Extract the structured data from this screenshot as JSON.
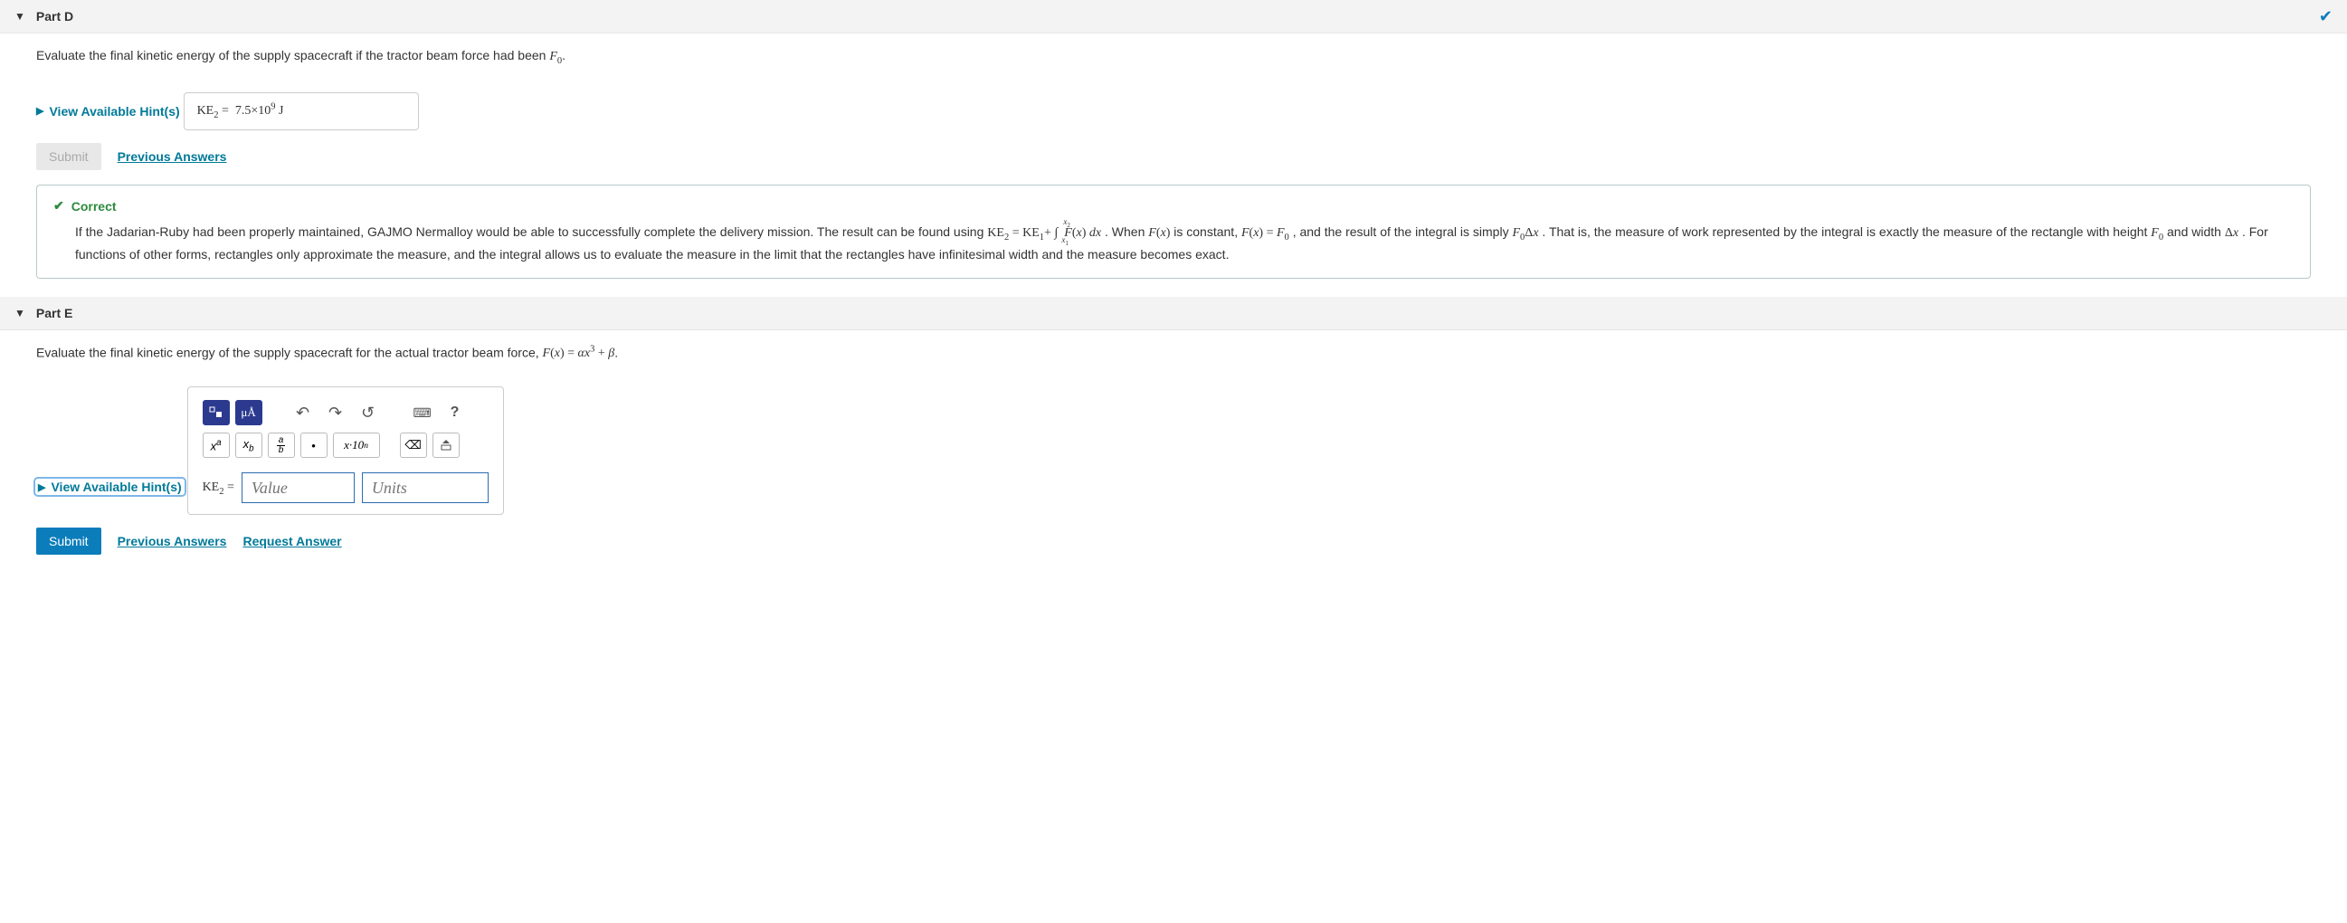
{
  "partD": {
    "title": "Part D",
    "prompt_pre": "Evaluate the final kinetic energy of the supply spacecraft if the tractor beam force had been ",
    "prompt_post": ".",
    "hints": "View Available Hint(s)",
    "answer_lhs": "KE",
    "answer_sub": "2",
    "answer_eq": " = ",
    "answer_val": "7.5×10",
    "answer_exp": "9",
    "answer_unit": " J",
    "submit": "Submit",
    "prev": "Previous Answers",
    "correct": "Correct",
    "fb_1": "If the Jadarian-Ruby had been properly maintained, GAJMO Nermalloy would be able to successfully complete the delivery mission. The result can be found using ",
    "fb_2": ". When ",
    "fb_3": " is constant, ",
    "fb_4": ", and the result of the integral is simply ",
    "fb_5": ". That is, the measure of work represented by the integral is exactly the measure of the rectangle with height ",
    "fb_6": " and width ",
    "fb_7": ". For functions of other forms, rectangles only approximate the measure, and the integral allows us to evaluate the measure in the limit that the rectangles have infinitesimal width and the measure becomes exact."
  },
  "partE": {
    "title": "Part E",
    "prompt_pre": "Evaluate the final kinetic energy of the supply spacecraft for the actual tractor beam force, ",
    "prompt_post": ".",
    "hints": "View Available Hint(s)",
    "lhs": "KE",
    "lhs_sub": "2",
    "eq": " = ",
    "value_ph": "Value",
    "units_ph": "Units",
    "submit": "Submit",
    "prev": "Previous Answers",
    "req": "Request Answer",
    "tb": {
      "templates": "▫◼",
      "greek": "μÅ",
      "undo": "↶",
      "redo": "↷",
      "reset": "↺",
      "keyboard": "⌨",
      "help": "?",
      "sup": "x",
      "sup_a": "a",
      "sub": "x",
      "sub_b": "b",
      "dot": "•",
      "sci": "x·10",
      "sci_n": "n",
      "bksp": "⌫"
    }
  }
}
